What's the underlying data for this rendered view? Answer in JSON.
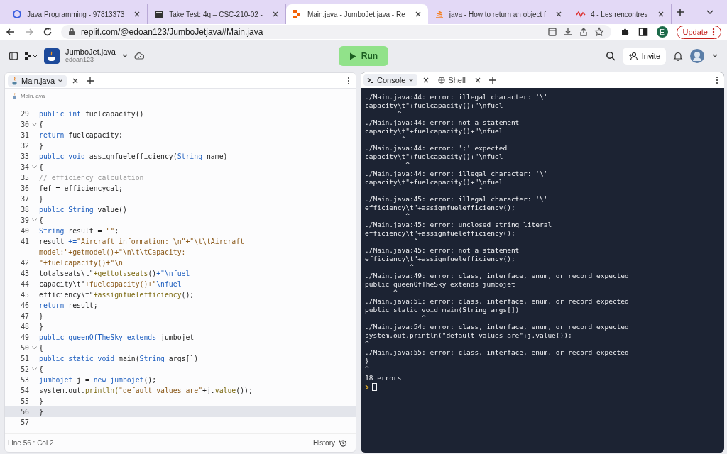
{
  "browser": {
    "tabs": [
      {
        "title": "Java Programming - 97813373",
        "selected": false
      },
      {
        "title": "Take Test: 4q – CSC-210-02 -",
        "selected": false
      },
      {
        "title": "Main.java - JumboJet.java - Re",
        "selected": true
      },
      {
        "title": "java - How to return an object f",
        "selected": false
      },
      {
        "title": "4 - Les rencontres",
        "selected": false
      }
    ],
    "address": "replit.com/@edoan123/JumboJetjava#Main.java",
    "profile": "E",
    "update": "Update"
  },
  "workspace": {
    "repl_name": "JumboJet.java",
    "owner": "edoan123",
    "run": "Run",
    "invite": "Invite"
  },
  "editor": {
    "tabs": [
      {
        "label": "Main.java",
        "selected": true
      }
    ],
    "breadcrumb": "Main.java",
    "lines": [
      {
        "number": "29",
        "fold": false,
        "active": false,
        "rows": [
          [
            {
              "text": "public int",
              "kind": "kw"
            },
            {
              "text": " fuelcapacity()",
              "kind": "plain"
            }
          ]
        ]
      },
      {
        "number": "30",
        "fold": true,
        "active": false,
        "rows": [
          [
            {
              "text": "{",
              "kind": "plain"
            }
          ]
        ]
      },
      {
        "number": "31",
        "fold": false,
        "active": false,
        "rows": [
          [
            {
              "text": "return",
              "kind": "kw"
            },
            {
              "text": " fuelcapacity;",
              "kind": "plain"
            }
          ]
        ]
      },
      {
        "number": "32",
        "fold": false,
        "active": false,
        "rows": [
          [
            {
              "text": "}",
              "kind": "plain"
            }
          ]
        ]
      },
      {
        "number": "33",
        "fold": false,
        "active": false,
        "rows": [
          [
            {
              "text": "public void",
              "kind": "kw"
            },
            {
              "text": " assignfuelefficiency(",
              "kind": "plain"
            },
            {
              "text": "String",
              "kind": "kw"
            },
            {
              "text": " name)",
              "kind": "plain"
            }
          ]
        ]
      },
      {
        "number": "34",
        "fold": true,
        "active": false,
        "rows": [
          [
            {
              "text": "{",
              "kind": "plain"
            }
          ]
        ]
      },
      {
        "number": "35",
        "fold": false,
        "active": false,
        "rows": [
          [
            {
              "text": "// efficiency calculation",
              "kind": "cmt"
            }
          ]
        ]
      },
      {
        "number": "36",
        "fold": false,
        "active": false,
        "rows": [
          [
            {
              "text": "fef = efficiencycal;",
              "kind": "plain"
            }
          ]
        ]
      },
      {
        "number": "37",
        "fold": false,
        "active": false,
        "rows": [
          [
            {
              "text": "}",
              "kind": "plain"
            }
          ]
        ]
      },
      {
        "number": "38",
        "fold": false,
        "active": false,
        "rows": [
          [
            {
              "text": "public String",
              "kind": "kw"
            },
            {
              "text": " value()",
              "kind": "plain"
            }
          ]
        ]
      },
      {
        "number": "39",
        "fold": true,
        "active": false,
        "rows": [
          [
            {
              "text": "{",
              "kind": "plain"
            }
          ]
        ]
      },
      {
        "number": "40",
        "fold": false,
        "active": false,
        "rows": [
          [
            {
              "text": "String",
              "kind": "kw"
            },
            {
              "text": " result = ",
              "kind": "plain"
            },
            {
              "text": "\"\"",
              "kind": "str"
            },
            {
              "text": ";",
              "kind": "plain"
            }
          ]
        ]
      },
      {
        "number": "41",
        "fold": false,
        "active": false,
        "rows": [
          [
            {
              "text": "result ",
              "kind": "plain"
            },
            {
              "text": "+=",
              "kind": "kw"
            },
            {
              "text": "\"Aircraft information: \\n\"+\"\\t\\tAircraft",
              "kind": "str"
            }
          ],
          [
            {
              "text": "model:\"+getmodel()+\"\\n\\t\\tCapacity:",
              "kind": "str"
            }
          ]
        ]
      },
      {
        "number": "42",
        "fold": false,
        "active": false,
        "rows": [
          [
            {
              "text": "\"+fuelcapacity()+\"\\n",
              "kind": "str"
            }
          ]
        ]
      },
      {
        "number": "43",
        "fold": false,
        "active": false,
        "rows": [
          [
            {
              "text": "totalseats\\t\"",
              "kind": "plain"
            },
            {
              "text": "+gettotsseats",
              "kind": "fn"
            },
            {
              "text": "()",
              "kind": "plain"
            },
            {
              "text": "+\"\\nfuel",
              "kind": "kw"
            }
          ]
        ]
      },
      {
        "number": "44",
        "fold": false,
        "active": false,
        "rows": [
          [
            {
              "text": "capacity\\t\"",
              "kind": "plain"
            },
            {
              "text": "+fuelcapacity()+\"",
              "kind": "str"
            },
            {
              "text": "\\nfuel",
              "kind": "kw"
            }
          ]
        ]
      },
      {
        "number": "45",
        "fold": false,
        "active": false,
        "rows": [
          [
            {
              "text": "efficiency\\t\"",
              "kind": "plain"
            },
            {
              "text": "+assignfuelefficiency",
              "kind": "fn"
            },
            {
              "text": "();",
              "kind": "plain"
            }
          ]
        ]
      },
      {
        "number": "46",
        "fold": false,
        "active": false,
        "rows": [
          [
            {
              "text": "return",
              "kind": "kw"
            },
            {
              "text": " result;",
              "kind": "plain"
            }
          ]
        ]
      },
      {
        "number": "47",
        "fold": false,
        "active": false,
        "rows": [
          [
            {
              "text": "}",
              "kind": "plain"
            }
          ]
        ]
      },
      {
        "number": "48",
        "fold": false,
        "active": false,
        "rows": [
          [
            {
              "text": "}",
              "kind": "plain"
            }
          ]
        ]
      },
      {
        "number": "49",
        "fold": false,
        "active": false,
        "rows": [
          [
            {
              "text": "public queenOfTheSky extends",
              "kind": "kw"
            },
            {
              "text": " jumbojet",
              "kind": "plain"
            }
          ]
        ]
      },
      {
        "number": "50",
        "fold": true,
        "active": false,
        "rows": [
          [
            {
              "text": "{",
              "kind": "plain"
            }
          ]
        ]
      },
      {
        "number": "51",
        "fold": false,
        "active": false,
        "rows": [
          [
            {
              "text": "public static void",
              "kind": "kw"
            },
            {
              "text": " main(",
              "kind": "plain"
            },
            {
              "text": "String",
              "kind": "kw"
            },
            {
              "text": " args[])",
              "kind": "plain"
            }
          ]
        ]
      },
      {
        "number": "52",
        "fold": true,
        "active": false,
        "rows": [
          [
            {
              "text": "{",
              "kind": "plain"
            }
          ]
        ]
      },
      {
        "number": "53",
        "fold": false,
        "active": false,
        "rows": [
          [
            {
              "text": "jumbojet",
              "kind": "kw"
            },
            {
              "text": " j = ",
              "kind": "plain"
            },
            {
              "text": "new jumbojet",
              "kind": "kw"
            },
            {
              "text": "();",
              "kind": "plain"
            }
          ]
        ]
      },
      {
        "number": "54",
        "fold": false,
        "active": false,
        "rows": [
          [
            {
              "text": "system.out.",
              "kind": "plain"
            },
            {
              "text": "println(",
              "kind": "fn"
            },
            {
              "text": "\"default values are\"",
              "kind": "str"
            },
            {
              "text": "+j.",
              "kind": "plain"
            },
            {
              "text": "value",
              "kind": "fn"
            },
            {
              "text": "());",
              "kind": "plain"
            }
          ]
        ]
      },
      {
        "number": "55",
        "fold": false,
        "active": false,
        "rows": [
          [
            {
              "text": "}",
              "kind": "plain"
            }
          ]
        ]
      },
      {
        "number": "56",
        "fold": false,
        "active": true,
        "rows": [
          [
            {
              "text": "}",
              "kind": "plain"
            }
          ]
        ]
      },
      {
        "number": "57",
        "fold": false,
        "active": false
      }
    ],
    "status": "Line 56 : Col 2",
    "history": "History"
  },
  "console": {
    "tabs": [
      {
        "label": "Console",
        "selected": true
      },
      {
        "label": "Shell",
        "selected": false
      }
    ],
    "errors": [
      {
        "message": "./Main.java:44: error: illegal character: '\\'",
        "source": "capacity\\t\"+fuelcapacity()+\"\\nfuel",
        "caret": "        ^"
      },
      {
        "message": "./Main.java:44: error: not a statement",
        "source": "capacity\\t\"+fuelcapacity()+\"\\nfuel",
        "caret": "         ^"
      },
      {
        "message": "./Main.java:44: error: ';' expected",
        "source": "capacity\\t\"+fuelcapacity()+\"\\nfuel",
        "caret": "          ^"
      },
      {
        "message": "./Main.java:44: error: illegal character: '\\'",
        "source": "capacity\\t\"+fuelcapacity()+\"\\nfuel",
        "caret": "                            ^"
      },
      {
        "message": "./Main.java:45: error: illegal character: '\\'",
        "source": "efficiency\\t\"+assignfuelefficiency();",
        "caret": "          ^"
      },
      {
        "message": "./Main.java:45: error: unclosed string literal",
        "source": "efficiency\\t\"+assignfuelefficiency();",
        "caret": "            ^"
      },
      {
        "message": "./Main.java:45: error: not a statement",
        "source": "efficiency\\t\"+assignfuelefficiency();",
        "caret": "           ^"
      },
      {
        "message": "./Main.java:49: error: class, interface, enum, or record expected",
        "source": "public queenOfTheSky extends jumbojet",
        "caret": "       ^"
      },
      {
        "message": "./Main.java:51: error: class, interface, enum, or record expected",
        "source": "public static void main(String args[])",
        "caret": "              ^"
      },
      {
        "message": "./Main.java:54: error: class, interface, enum, or record expected",
        "source": "system.out.println(\"default values are\"+j.value());",
        "caret": "^"
      },
      {
        "message": "./Main.java:55: error: class, interface, enum, or record expected",
        "source": "}",
        "caret": "^"
      }
    ],
    "summary": "18 errors"
  }
}
